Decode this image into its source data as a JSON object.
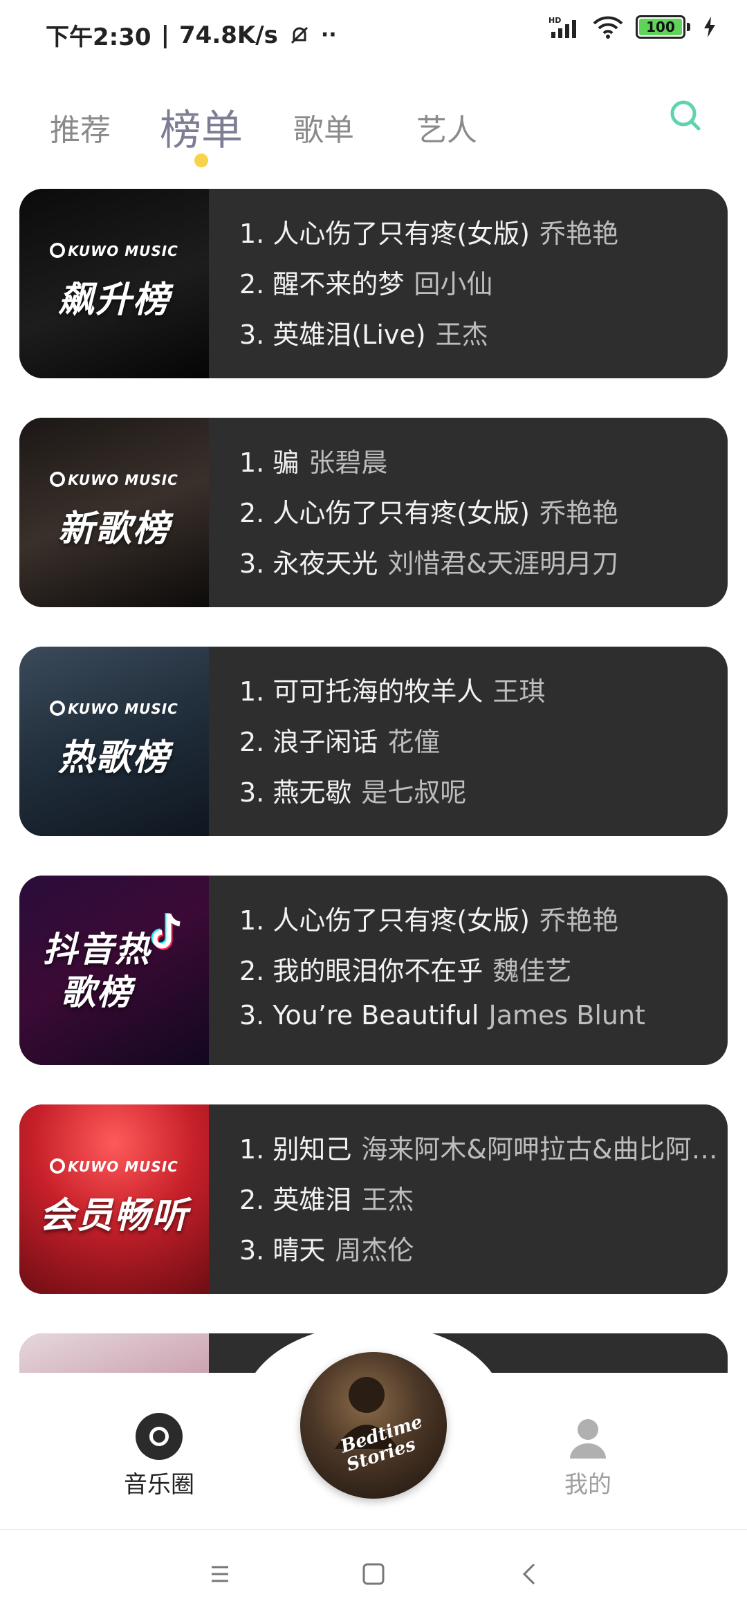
{
  "status_bar": {
    "time": "下午2:30",
    "net_speed": "74.8K/s",
    "battery": "100",
    "battery_level": 1.0
  },
  "tabs": [
    {
      "label": "推荐",
      "active": false
    },
    {
      "label": "榜单",
      "active": true
    },
    {
      "label": "歌单",
      "active": false
    },
    {
      "label": "艺人",
      "active": false
    }
  ],
  "charts": [
    {
      "cover_brand": "KUWO MUSIC",
      "cover_label": "飙升榜",
      "songs": [
        {
          "rank": "1.",
          "title": "人心伤了只有疼(女版)",
          "artist": "乔艳艳"
        },
        {
          "rank": "2.",
          "title": "醒不来的梦",
          "artist": "回小仙"
        },
        {
          "rank": "3.",
          "title": "英雄泪(Live)",
          "artist": "王杰"
        }
      ]
    },
    {
      "cover_brand": "KUWO MUSIC",
      "cover_label": "新歌榜",
      "songs": [
        {
          "rank": "1.",
          "title": "骗",
          "artist": "张碧晨"
        },
        {
          "rank": "2.",
          "title": "人心伤了只有疼(女版)",
          "artist": "乔艳艳"
        },
        {
          "rank": "3.",
          "title": "永夜天光",
          "artist": "刘惜君&天涯明月刀"
        }
      ]
    },
    {
      "cover_brand": "KUWO MUSIC",
      "cover_label": "热歌榜",
      "songs": [
        {
          "rank": "1.",
          "title": "可可托海的牧羊人",
          "artist": "王琪"
        },
        {
          "rank": "2.",
          "title": "浪子闲话",
          "artist": "花僮"
        },
        {
          "rank": "3.",
          "title": "燕无歇",
          "artist": "是七叔呢"
        }
      ]
    },
    {
      "cover_brand": "",
      "cover_label": "抖音热歌榜",
      "songs": [
        {
          "rank": "1.",
          "title": "人心伤了只有疼(女版)",
          "artist": "乔艳艳"
        },
        {
          "rank": "2.",
          "title": "我的眼泪你不在乎",
          "artist": "魏佳艺"
        },
        {
          "rank": "3.",
          "title": "You’re Beautiful",
          "artist": "James Blunt"
        }
      ]
    },
    {
      "cover_brand": "KUWO MUSIC",
      "cover_label": "会员畅听",
      "songs": [
        {
          "rank": "1.",
          "title": "别知己",
          "artist": "海来阿木&阿呷拉古&曲比阿…"
        },
        {
          "rank": "2.",
          "title": "英雄泪",
          "artist": "王杰"
        },
        {
          "rank": "3.",
          "title": "晴天",
          "artist": "周杰伦"
        }
      ]
    },
    {
      "cover_brand": "",
      "cover_label": "",
      "songs": []
    }
  ],
  "bottom_nav": {
    "left_label": "音乐圈",
    "right_label": "我的",
    "now_playing_cover_text": "Bedtime Stories"
  },
  "colors": {
    "active_tab": "#7d7e95",
    "tab_indicator": "#f7d24c",
    "search_icon": "#5fd3b0",
    "card_bg": "#2e2e2e"
  }
}
